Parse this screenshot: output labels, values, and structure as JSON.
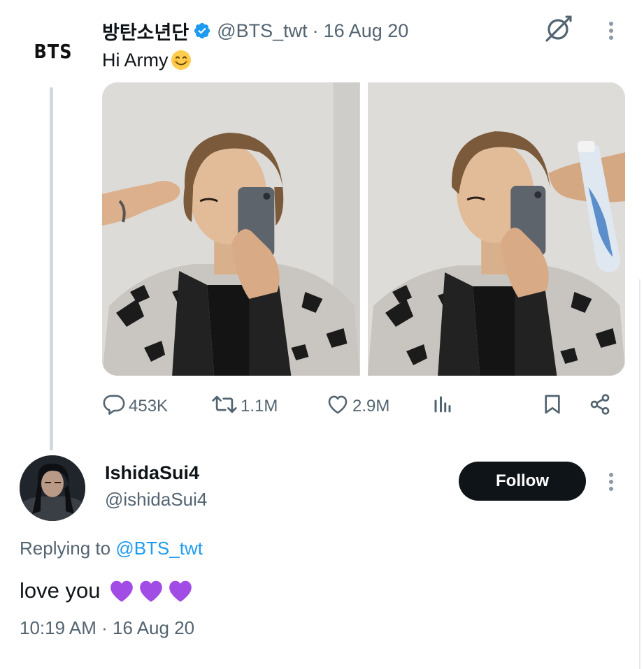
{
  "tweet": {
    "author_logo": "BTS",
    "display_name": "방탄소년단",
    "handle": "@BTS_twt",
    "separator": "·",
    "date": "16 Aug 20",
    "text": "Hi Army",
    "text_emoji": "smiling-face-emoji",
    "media": [
      {
        "name": "photo-1"
      },
      {
        "name": "photo-2"
      }
    ],
    "stats": {
      "replies": "453K",
      "retweets": "1.1M",
      "likes": "2.9M"
    },
    "icons": [
      "verified-badge-icon",
      "grok-icon",
      "more-icon",
      "reply-icon",
      "retweet-icon",
      "like-icon",
      "views-icon",
      "bookmark-icon",
      "share-icon"
    ]
  },
  "reply": {
    "display_name": "IshidaSui4",
    "handle": "@ishidaSui4",
    "follow_label": "Follow",
    "replying_prefix": "Replying to",
    "replying_to": "@BTS_twt",
    "text": "love you",
    "emoji": [
      "purple-heart",
      "purple-heart",
      "purple-heart"
    ],
    "time": "10:19 AM",
    "separator": "·",
    "date": "16 Aug 20"
  },
  "colors": {
    "text_primary": "#0f1419",
    "text_secondary": "#536471",
    "link": "#1d9bf0",
    "verified": "#1d9bf0",
    "button_bg": "#0f1419",
    "thread_line": "#cfd9de",
    "purple_heart": "#a24ce6"
  }
}
